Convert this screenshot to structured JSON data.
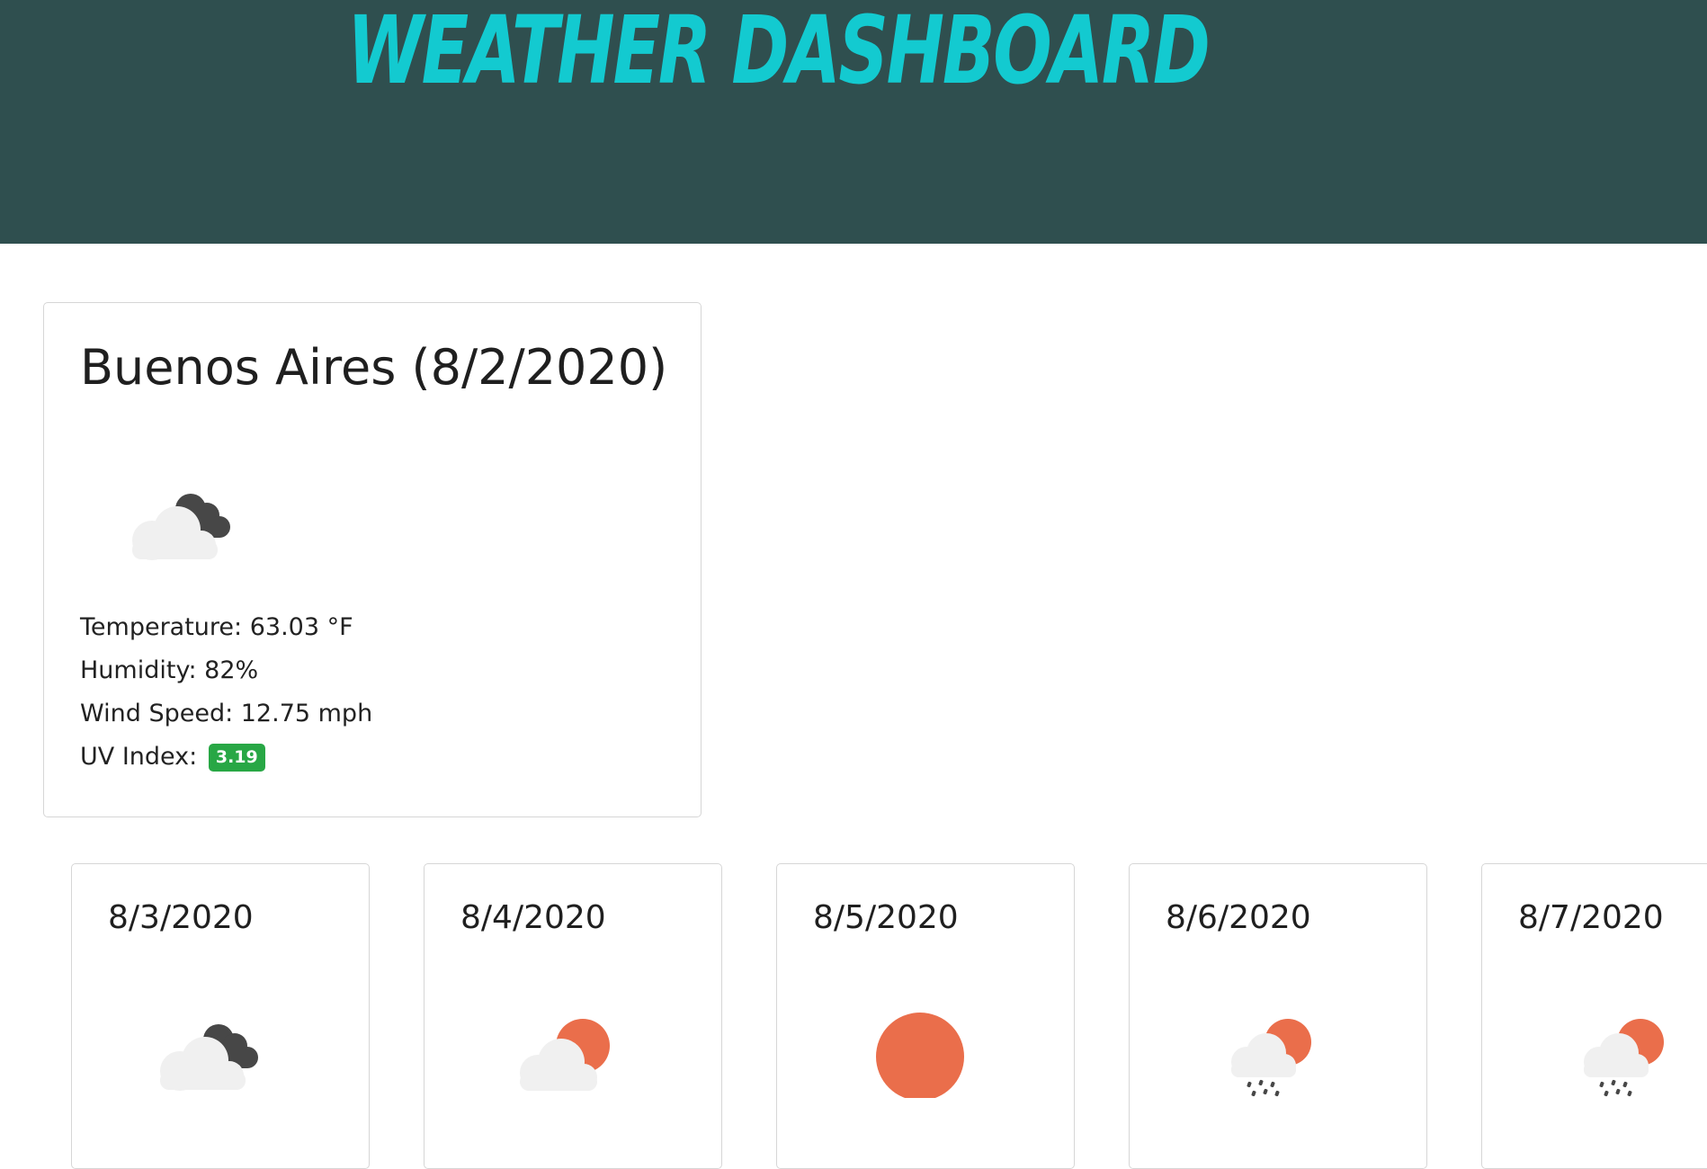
{
  "header": {
    "title": "Weather Dashboard"
  },
  "current": {
    "title": "Buenos Aires (8/2/2020)",
    "icon": "cloudy-dark-cloud-icon",
    "temperature": "Temperature: 63.03 °F",
    "humidity": "Humidity: 82%",
    "wind": "Wind Speed: 12.75 mph",
    "uv_label": "UV Index:",
    "uv_value": "3.19",
    "uv_color": "#28a745"
  },
  "forecast": [
    {
      "date": "8/3/2020",
      "icon": "cloudy-dark-cloud-icon"
    },
    {
      "date": "8/4/2020",
      "icon": "partly-cloudy-sun-icon"
    },
    {
      "date": "8/5/2020",
      "icon": "sun-icon"
    },
    {
      "date": "8/6/2020",
      "icon": "rain-sun-icon"
    },
    {
      "date": "8/7/2020",
      "icon": "rain-sun-icon"
    }
  ],
  "colors": {
    "header_bg": "#2f4f4f",
    "title": "#13cad0",
    "sun": "#ea6e4b",
    "cloud_light": "#f0f0f0",
    "cloud_dark": "#474747"
  }
}
